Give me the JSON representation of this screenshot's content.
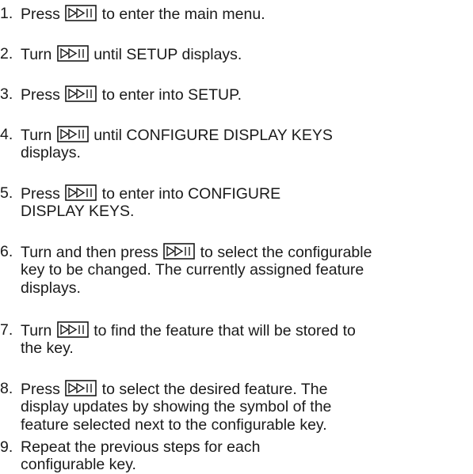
{
  "steps": [
    {
      "number": "1.",
      "lines": [
        {
          "before": "Press ",
          "icon": true,
          "after": " to enter the main menu."
        }
      ]
    },
    {
      "number": "2.",
      "lines": [
        {
          "before": "Turn ",
          "icon": true,
          "after": " until SETUP displays."
        }
      ]
    },
    {
      "number": "3.",
      "lines": [
        {
          "before": "Press ",
          "icon": true,
          "after": " to enter into SETUP."
        }
      ]
    },
    {
      "number": "4.",
      "lines": [
        {
          "before": "Turn ",
          "icon": true,
          "after": " until CONFIGURE DISPLAY KEYS"
        },
        {
          "text": "displays."
        }
      ]
    },
    {
      "number": "5.",
      "lines": [
        {
          "before": "Press ",
          "icon": true,
          "after": " to enter into CONFIGURE"
        },
        {
          "text": "DISPLAY KEYS."
        }
      ]
    },
    {
      "number": "6.",
      "lines": [
        {
          "before": "Turn and then press ",
          "icon": true,
          "after": " to select the configurable"
        },
        {
          "text": "key to be changed. The currently assigned feature"
        },
        {
          "text": "displays."
        }
      ]
    },
    {
      "number": "7.",
      "lines": [
        {
          "before": "Turn ",
          "icon": true,
          "after": " to find the feature that will be stored to"
        },
        {
          "text": "the key."
        }
      ]
    },
    {
      "number": "8.",
      "lines": [
        {
          "before": "Press ",
          "icon": true,
          "after": " to select the desired feature. The"
        },
        {
          "text": "display updates by showing the symbol of the"
        },
        {
          "text": "feature selected next to the configurable key."
        }
      ]
    },
    {
      "number": "9.",
      "lines": [
        {
          "text": "Repeat the previous steps for each"
        },
        {
          "text": "configurable key."
        }
      ]
    }
  ],
  "icon_name": "play-pause-key-icon"
}
